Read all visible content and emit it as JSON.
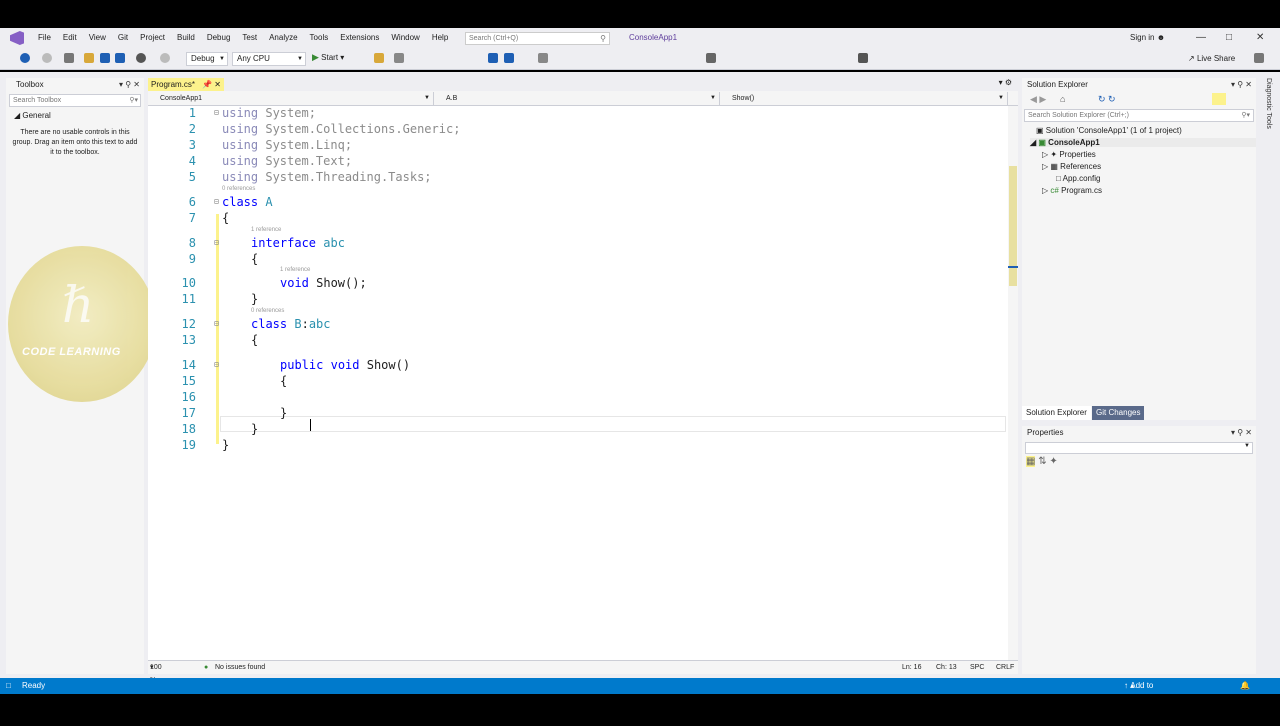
{
  "menu": [
    "File",
    "Edit",
    "View",
    "Git",
    "Project",
    "Build",
    "Debug",
    "Test",
    "Analyze",
    "Tools",
    "Extensions",
    "Window",
    "Help"
  ],
  "search_placeholder": "Search (Ctrl+Q)",
  "app_title": "ConsoleApp1",
  "sign_in": "Sign in",
  "toolbar": {
    "config": "Debug",
    "platform": "Any CPU",
    "start": "Start",
    "live_share": "Live Share"
  },
  "toolbox": {
    "title": "Toolbox",
    "search_placeholder": "Search Toolbox",
    "group": "General",
    "message": "There are no usable controls in this group. Drag an item onto this text to add it to the toolbox."
  },
  "logo_text": "CODE LEARNING",
  "editor": {
    "tab": "Program.cs*",
    "nav_project": "ConsoleApp1",
    "nav_type": "A.B",
    "nav_member": "Show()",
    "lines": [
      {
        "n": "1",
        "text": "using System;"
      },
      {
        "n": "2",
        "text": "using System.Collections.Generic;"
      },
      {
        "n": "3",
        "text": "using System.Linq;"
      },
      {
        "n": "4",
        "text": "using System.Text;"
      },
      {
        "n": "5",
        "text": "using System.Threading.Tasks;"
      },
      {
        "n": "6",
        "text": "class A"
      },
      {
        "n": "7",
        "text": "{"
      },
      {
        "n": "8",
        "text": "interface abc"
      },
      {
        "n": "9",
        "text": "{"
      },
      {
        "n": "10",
        "text": "void Show();"
      },
      {
        "n": "11",
        "text": "}"
      },
      {
        "n": "12",
        "text": "class B:abc"
      },
      {
        "n": "13",
        "text": "{"
      },
      {
        "n": "14",
        "text": "public void Show()"
      },
      {
        "n": "15",
        "text": "{"
      },
      {
        "n": "16",
        "text": ""
      },
      {
        "n": "17",
        "text": "}"
      },
      {
        "n": "18",
        "text": "}"
      },
      {
        "n": "19",
        "text": "}"
      }
    ],
    "refs": {
      "classA": "0 references",
      "interface": "1 reference",
      "show": "1 reference",
      "classB": "0 references"
    },
    "status": {
      "zoom": "100 %",
      "issues": "No issues found",
      "ln": "Ln: 16",
      "ch": "Ch: 13",
      "spc": "SPC",
      "crlf": "CRLF"
    }
  },
  "solution_explorer": {
    "title": "Solution Explorer",
    "search_placeholder": "Search Solution Explorer (Ctrl+;)",
    "solution": "Solution 'ConsoleApp1' (1 of 1 project)",
    "project": "ConsoleApp1",
    "items": [
      "Properties",
      "References",
      "App.config",
      "Program.cs"
    ],
    "tabs": [
      "Solution Explorer",
      "Git Changes"
    ]
  },
  "properties": {
    "title": "Properties"
  },
  "side_strip": "Diagnostic Tools",
  "bottom": {
    "status": "Ready",
    "source_control": "Add to Source Control"
  }
}
